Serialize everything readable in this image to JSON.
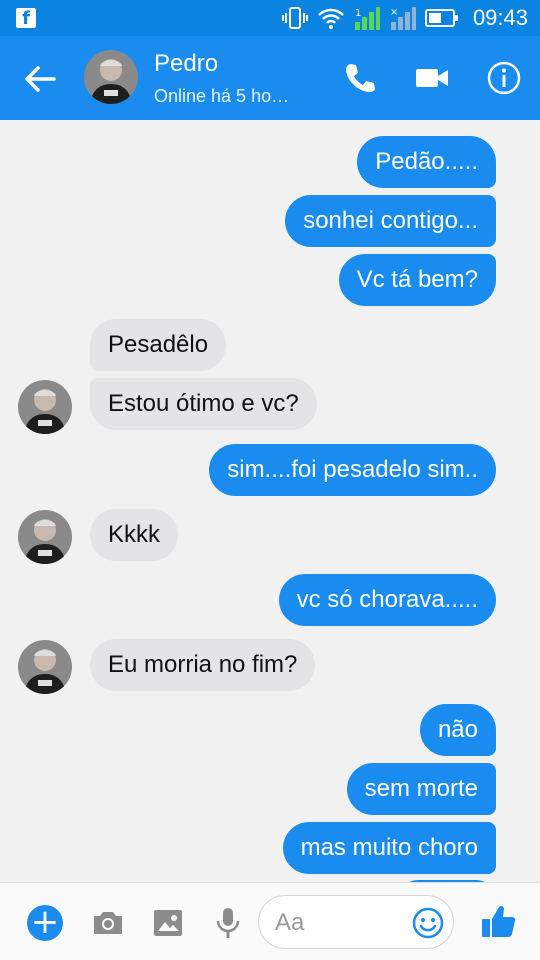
{
  "status_bar": {
    "app_icon": "facebook-icon",
    "time": "09:43",
    "icons": [
      "vibrate-icon",
      "wifi-icon",
      "signal-1-icon",
      "signal-2-icon",
      "battery-icon"
    ]
  },
  "header": {
    "contact_name": "Pedro",
    "contact_status": "Online há 5 ho…",
    "icons": [
      "back-arrow-icon",
      "phone-icon",
      "video-camera-icon",
      "info-icon"
    ]
  },
  "messages": [
    {
      "side": "out",
      "text": "Pedão....."
    },
    {
      "side": "out",
      "text": "sonhei contigo..."
    },
    {
      "side": "out",
      "text": "Vc tá bem?"
    },
    {
      "side": "in",
      "text": "Pesadêlo"
    },
    {
      "side": "in",
      "text": "Estou ótimo e vc?"
    },
    {
      "side": "out",
      "text": "sim....foi pesadelo sim.."
    },
    {
      "side": "in",
      "text": "Kkkk"
    },
    {
      "side": "out",
      "text": "vc só chorava....."
    },
    {
      "side": "in",
      "text": "Eu morria no fim?"
    },
    {
      "side": "out",
      "text": "não"
    },
    {
      "side": "out",
      "text": "sem morte"
    },
    {
      "side": "out",
      "text": "mas muito choro"
    }
  ],
  "composer": {
    "placeholder": "Aa",
    "icons": [
      "plus-icon",
      "camera-icon",
      "image-icon",
      "microphone-icon",
      "emoji-icon",
      "thumbs-up-icon"
    ]
  },
  "colors": {
    "accent": "#1a8cf0",
    "status_bar": "#0a84e0",
    "incoming_bubble": "#e4e4e6",
    "background": "#f1f1f1"
  }
}
